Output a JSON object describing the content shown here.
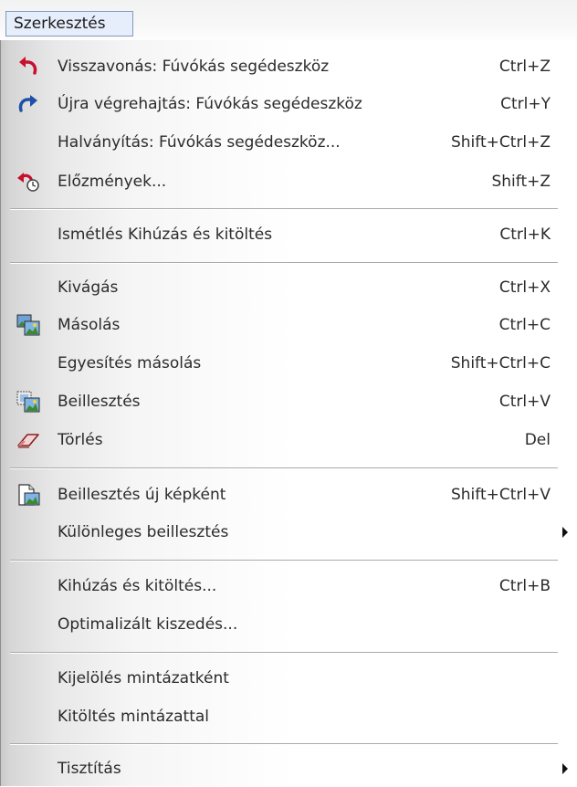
{
  "menubar": {
    "edit_label": "Szerkesztés"
  },
  "menu": {
    "items": [
      {
        "label": "Visszavonás:  Fúvókás segédeszköz",
        "shortcut": "Ctrl+Z",
        "icon": "undo-icon"
      },
      {
        "label": "Újra végrehajtás:  Fúvókás segédeszköz",
        "shortcut": "Ctrl+Y",
        "icon": "redo-icon"
      },
      {
        "label": "Halványítás:  Fúvókás segédeszköz...",
        "shortcut": "Shift+Ctrl+Z",
        "icon": ""
      },
      {
        "label": "Előzmények...",
        "shortcut": "Shift+Z",
        "icon": "history-icon"
      },
      {
        "label": "Ismétlés Kihúzás és kitöltés",
        "shortcut": "Ctrl+K",
        "icon": ""
      },
      {
        "label": "Kivágás",
        "shortcut": "Ctrl+X",
        "icon": ""
      },
      {
        "label": "Másolás",
        "shortcut": "Ctrl+C",
        "icon": "copy-icon"
      },
      {
        "label": "Egyesítés másolás",
        "shortcut": "Shift+Ctrl+C",
        "icon": ""
      },
      {
        "label": "Beillesztés",
        "shortcut": "Ctrl+V",
        "icon": "paste-icon"
      },
      {
        "label": "Törlés",
        "shortcut": "Del",
        "icon": "eraser-icon"
      },
      {
        "label": "Beillesztés új képként",
        "shortcut": "Shift+Ctrl+V",
        "icon": "paste-as-new-image-icon"
      },
      {
        "label": "Különleges beillesztés",
        "shortcut": "",
        "icon": "",
        "submenu": true
      },
      {
        "label": "Kihúzás és kitöltés...",
        "shortcut": "Ctrl+B",
        "icon": ""
      },
      {
        "label": "Optimalizált kiszedés...",
        "shortcut": "",
        "icon": ""
      },
      {
        "label": "Kijelölés mintázatként",
        "shortcut": "",
        "icon": ""
      },
      {
        "label": "Kitöltés mintázattal",
        "shortcut": "",
        "icon": ""
      },
      {
        "label": "Tisztítás",
        "shortcut": "",
        "icon": "",
        "submenu": true
      }
    ]
  },
  "colors": {
    "undo_red": "#c8102e",
    "redo_blue": "#1f4fa8",
    "menu_border": "#7f9db9",
    "menu_highlight": "#e6eefb"
  }
}
